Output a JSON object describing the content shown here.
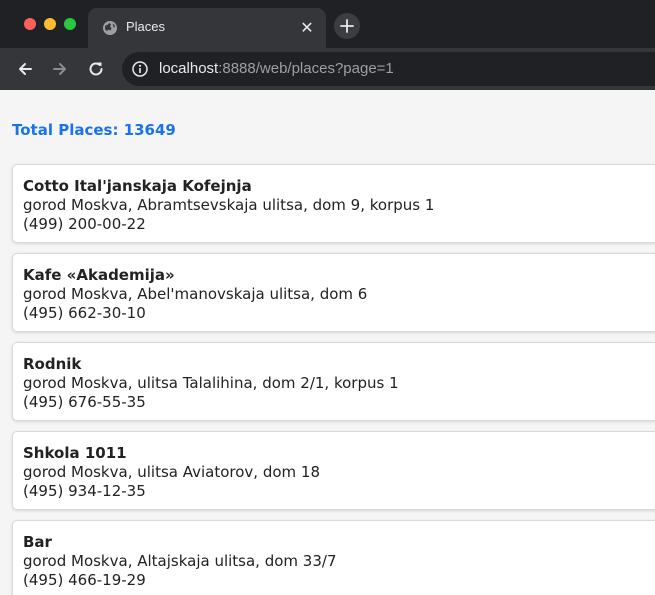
{
  "tab": {
    "title": "Places",
    "close": "✕"
  },
  "address_bar": {
    "host": "localhost",
    "rest": ":8888/web/places?page=1"
  },
  "total": "Total Places: 13649",
  "places": [
    {
      "name": "Cotto Ital'janskaja Kofejnja",
      "address": "gorod Moskva, Abramtsevskaja ulitsa, dom 9, korpus 1",
      "phone": "(499) 200-00-22"
    },
    {
      "name": "Kafe «Akademija»",
      "address": "gorod Moskva, Abel'manovskaja ulitsa, dom 6",
      "phone": "(495) 662-30-10"
    },
    {
      "name": "Rodnik",
      "address": "gorod Moskva, ulitsa Talalihina, dom 2/1, korpus 1",
      "phone": "(495) 676-55-35"
    },
    {
      "name": "Shkola 1011",
      "address": "gorod Moskva, ulitsa Aviatorov, dom 18",
      "phone": "(495) 934-12-35"
    },
    {
      "name": "Bar",
      "address": "gorod Moskva, Altajskaja ulitsa, dom 33/7",
      "phone": "(495) 466-19-29"
    }
  ],
  "icons": {
    "tab_favicon": "globe-icon",
    "new_tab": "plus-icon",
    "back": "arrow-left-icon",
    "forward": "arrow-right-icon",
    "reload": "reload-icon",
    "site_info": "site-info-icon"
  },
  "colors": {
    "accent": "#1a73e8",
    "chrome": "#35363a",
    "titlebar": "#1f2124"
  }
}
